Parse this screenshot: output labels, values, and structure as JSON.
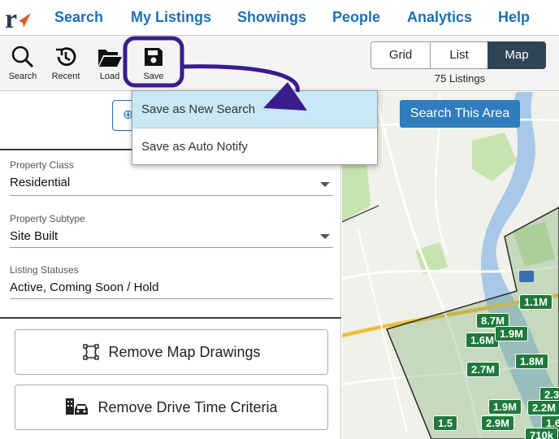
{
  "nav": {
    "links": [
      "Search",
      "My Listings",
      "Showings",
      "People",
      "Analytics",
      "Help"
    ]
  },
  "toolbar": {
    "search": "Search",
    "recent": "Recent",
    "load": "Load",
    "save": "Save",
    "views": [
      "Grid",
      "List",
      "Map"
    ],
    "active_view": "Map",
    "listing_count": "75 Listings"
  },
  "save_menu": {
    "items": [
      "Save as New Search",
      "Save as Auto Notify"
    ]
  },
  "filters": {
    "property_class": {
      "label": "Property Class",
      "value": "Residential"
    },
    "property_subtype": {
      "label": "Property Subtype",
      "value": "Site Built"
    },
    "listing_statuses": {
      "label": "Listing Statuses",
      "value": "Active, Coming Soon / Hold"
    }
  },
  "actions": {
    "remove_map_drawings": "Remove Map Drawings",
    "remove_drive_time": "Remove Drive Time Criteria"
  },
  "map": {
    "search_area_button": "Search This Area",
    "pins": [
      "1.1M",
      "1.6M",
      "1.9M",
      "1.8M",
      "2.7M",
      "2.3",
      "1.9M",
      "2.2M",
      "2.9M",
      "1.6",
      "1.5",
      "710k"
    ]
  },
  "colors": {
    "brand_blue": "#1d6fb8",
    "annotation_purple": "#3b1c8c",
    "pin_green": "#1f7a3c",
    "highlight": "#c8e8f6"
  }
}
